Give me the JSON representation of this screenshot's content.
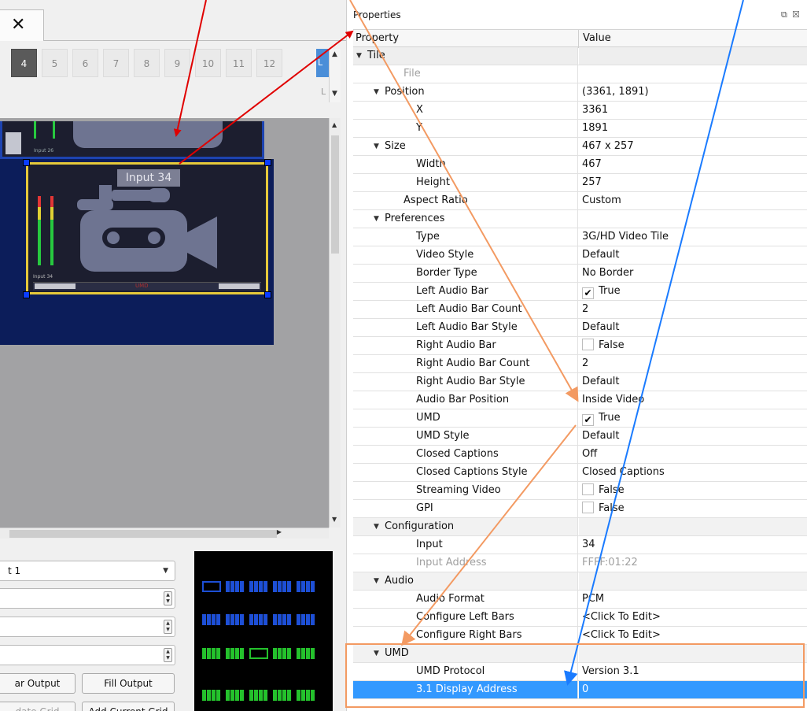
{
  "left_panel": {
    "tab_close_glyph": "✕",
    "output_tabs": [
      "4",
      "5",
      "6",
      "7",
      "8",
      "9",
      "10",
      "11",
      "12"
    ],
    "active_tab": "4",
    "canvas": {
      "tile_top_label": "Input 26",
      "tile_main_title": "Input 34",
      "tile_main_label": "Input 34",
      "tile_main_umd": "UMD"
    },
    "combo_value": "t 1",
    "buttons": {
      "clear_output": "ar Output",
      "fill_output": "Fill Output",
      "update_grid": "date Grid",
      "add_current_grid": "Add Current Grid"
    }
  },
  "properties": {
    "title": "Properties",
    "col_property": "Property",
    "col_value": "Value",
    "rows": [
      {
        "name": "Tile",
        "value": "",
        "level": 0,
        "expander": "▼",
        "kind": "group"
      },
      {
        "name": "File",
        "value": "",
        "level": 2,
        "kind": "disabled"
      },
      {
        "name": "Position",
        "value": "(3361, 1891)",
        "level": 1,
        "expander": "▼"
      },
      {
        "name": "X",
        "value": "3361",
        "level": 3
      },
      {
        "name": "Y",
        "value": "1891",
        "level": 3
      },
      {
        "name": "Size",
        "value": "467 x 257",
        "level": 1,
        "expander": "▼"
      },
      {
        "name": "Width",
        "value": "467",
        "level": 3
      },
      {
        "name": "Height",
        "value": "257",
        "level": 3
      },
      {
        "name": "Aspect Ratio",
        "value": "Custom",
        "level": 2
      },
      {
        "name": "Preferences",
        "value": "",
        "level": 1,
        "expander": "▼"
      },
      {
        "name": "Type",
        "value": "3G/HD Video Tile",
        "level": 3
      },
      {
        "name": "Video Style",
        "value": "Default",
        "level": 3
      },
      {
        "name": "Border Type",
        "value": "No Border",
        "level": 3
      },
      {
        "name": "Left Audio Bar",
        "value": "True",
        "level": 3,
        "checkbox": "✔"
      },
      {
        "name": "Left Audio Bar Count",
        "value": "2",
        "level": 3
      },
      {
        "name": "Left Audio Bar Style",
        "value": "Default",
        "level": 3
      },
      {
        "name": "Right Audio Bar",
        "value": "False",
        "level": 3,
        "checkbox": ""
      },
      {
        "name": "Right Audio Bar Count",
        "value": "2",
        "level": 3
      },
      {
        "name": "Right Audio Bar Style",
        "value": "Default",
        "level": 3
      },
      {
        "name": "Audio Bar Position",
        "value": "Inside Video",
        "level": 3
      },
      {
        "name": "UMD",
        "value": "True",
        "level": 3,
        "checkbox": "✔"
      },
      {
        "name": "UMD Style",
        "value": "Default",
        "level": 3
      },
      {
        "name": "Closed Captions",
        "value": "Off",
        "level": 3
      },
      {
        "name": "Closed Captions Style",
        "value": "Closed Captions",
        "level": 3
      },
      {
        "name": "Streaming Video",
        "value": "False",
        "level": 3,
        "checkbox": ""
      },
      {
        "name": "GPI",
        "value": "False",
        "level": 3,
        "checkbox": ""
      },
      {
        "name": "Configuration",
        "value": "",
        "level": 1,
        "expander": "▼",
        "kind": "groupsub"
      },
      {
        "name": "Input",
        "value": "34",
        "level": 3
      },
      {
        "name": "Input Address",
        "value": "FFFF:01:22",
        "level": 3,
        "kind": "disabled"
      },
      {
        "name": "Audio",
        "value": "",
        "level": 1,
        "expander": "▼",
        "kind": "groupsub"
      },
      {
        "name": "Audio Format",
        "value": "PCM",
        "level": 3
      },
      {
        "name": "Configure Left Bars",
        "value": "<Click To Edit>",
        "level": 3
      },
      {
        "name": "Configure Right Bars",
        "value": "<Click To Edit>",
        "level": 3
      },
      {
        "name": "UMD",
        "value": "",
        "level": 1,
        "expander": "▼",
        "kind": "groupsub"
      },
      {
        "name": "UMD Protocol",
        "value": "Version 3.1",
        "level": 3
      },
      {
        "name": "3.1 Display Address",
        "value": "0",
        "level": 3,
        "kind": "sel"
      }
    ]
  },
  "colors": {
    "selection": "#3399ff",
    "annotation_red": "#e00000",
    "annotation_orange": "#f39a62",
    "annotation_blue": "#1a7bff"
  }
}
